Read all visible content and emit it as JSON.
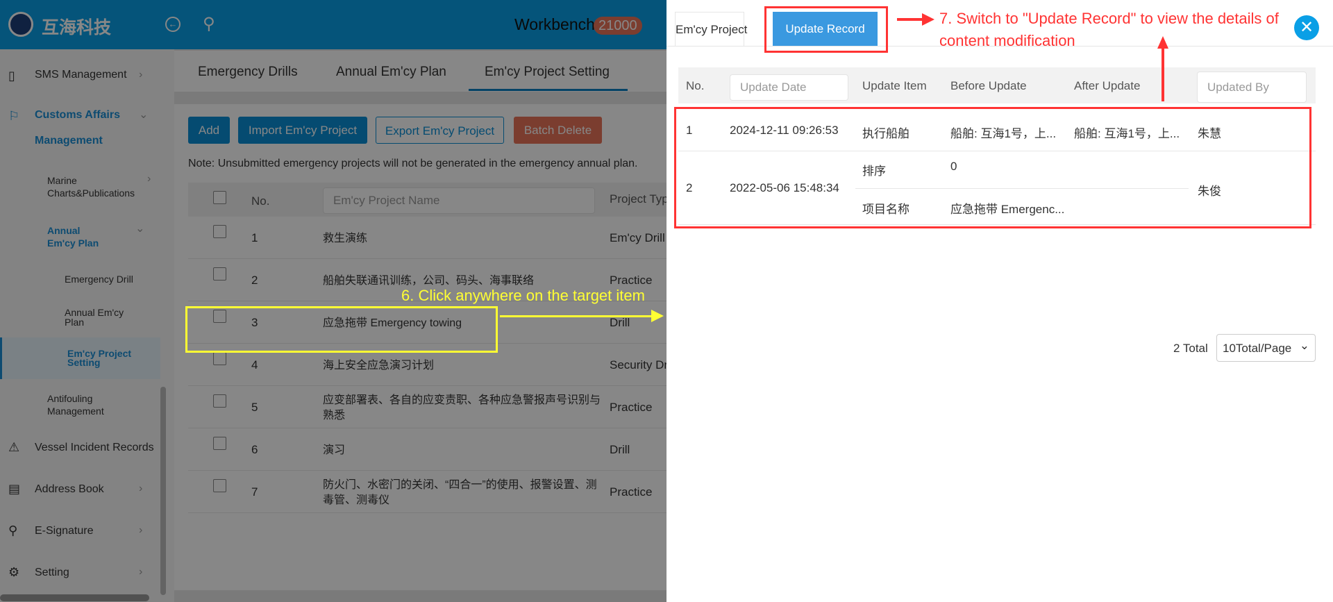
{
  "header": {
    "logo_text": "互海科技",
    "title": "Workbench",
    "badge": "21000"
  },
  "sidebar": {
    "items": [
      {
        "label": "SMS Management"
      },
      {
        "label": "Customs Affairs"
      },
      {
        "label": "Management"
      },
      {
        "label": "Marine Charts&Publications"
      },
      {
        "label": "Annual Em'cy Plan"
      },
      {
        "label": "Emergency Drill"
      },
      {
        "label": "Annual Em'cy Plan"
      },
      {
        "label": "Em'cy Project Setting"
      },
      {
        "label": "Antifouling Management"
      },
      {
        "label": "Vessel Incident Records"
      },
      {
        "label": "Address Book"
      },
      {
        "label": "E-Signature"
      },
      {
        "label": "Setting"
      }
    ]
  },
  "main": {
    "tabs": [
      "Emergency Drills",
      "Annual Em'cy Plan",
      "Em'cy Project Setting"
    ],
    "buttons": {
      "add": "Add",
      "import": "Import Em'cy Project",
      "export": "Export Em'cy Project",
      "batch_delete": "Batch Delete"
    },
    "note": "Note: Unsubmitted emergency projects will not be generated in the emergency annual plan.",
    "columns": {
      "no": "No.",
      "name_placeholder": "Em'cy Project Name",
      "type": "Project Typ"
    },
    "rows": [
      {
        "no": "1",
        "name": "救生演练",
        "type": "Em'cy Drill"
      },
      {
        "no": "2",
        "name": "船舶失联通讯训练，公司、码头、海事联络",
        "type": "Practice"
      },
      {
        "no": "3",
        "name": "应急拖带 Emergency towing",
        "type": "Drill"
      },
      {
        "no": "4",
        "name": "海上安全应急演习计划",
        "type": "Security Dr"
      },
      {
        "no": "5",
        "name": "应变部署表、各自的应变责职、各种应急警报声号识别与熟悉",
        "type": "Practice"
      },
      {
        "no": "6",
        "name": "演习",
        "type": "Drill"
      },
      {
        "no": "7",
        "name": "防火门、水密门的关闭、“四合一”的使用、报警设置、测毒管、测毒仪",
        "type": "Practice"
      }
    ]
  },
  "panel": {
    "tabs": [
      "Em'cy Project",
      "Update Record"
    ],
    "columns": {
      "no": "No.",
      "update_date": "Update Date",
      "update_item": "Update Item",
      "before": "Before Update",
      "after": "After Update",
      "updated_by": "Updated By"
    },
    "records": [
      {
        "no": "1",
        "date": "2024-12-11 09:26:53",
        "items": [
          {
            "item": "执行船舶",
            "before": "船舶: 互海1号，上...",
            "after": "船舶: 互海1号，上..."
          }
        ],
        "by": "朱慧"
      },
      {
        "no": "2",
        "date": "2022-05-06 15:48:34",
        "items": [
          {
            "item": "排序",
            "before": "0",
            "after": ""
          },
          {
            "item": "项目名称",
            "before": "应急拖带 Emergenc...",
            "after": ""
          }
        ],
        "by": "朱俊"
      }
    ],
    "pagination": {
      "total": "2 Total",
      "page_size": "10Total/Page"
    }
  },
  "annotations": {
    "step6": "6. Click anywhere on the target item",
    "step7_line1": "7. Switch to \"Update Record\" to view the details of",
    "step7_line2": "content modification"
  },
  "colors": {
    "primary": "#0a9fe6",
    "panel_tab_active": "#3a99e0",
    "danger": "#e8735a",
    "annotation_red": "#ff3333",
    "annotation_yellow": "#ffff33"
  }
}
